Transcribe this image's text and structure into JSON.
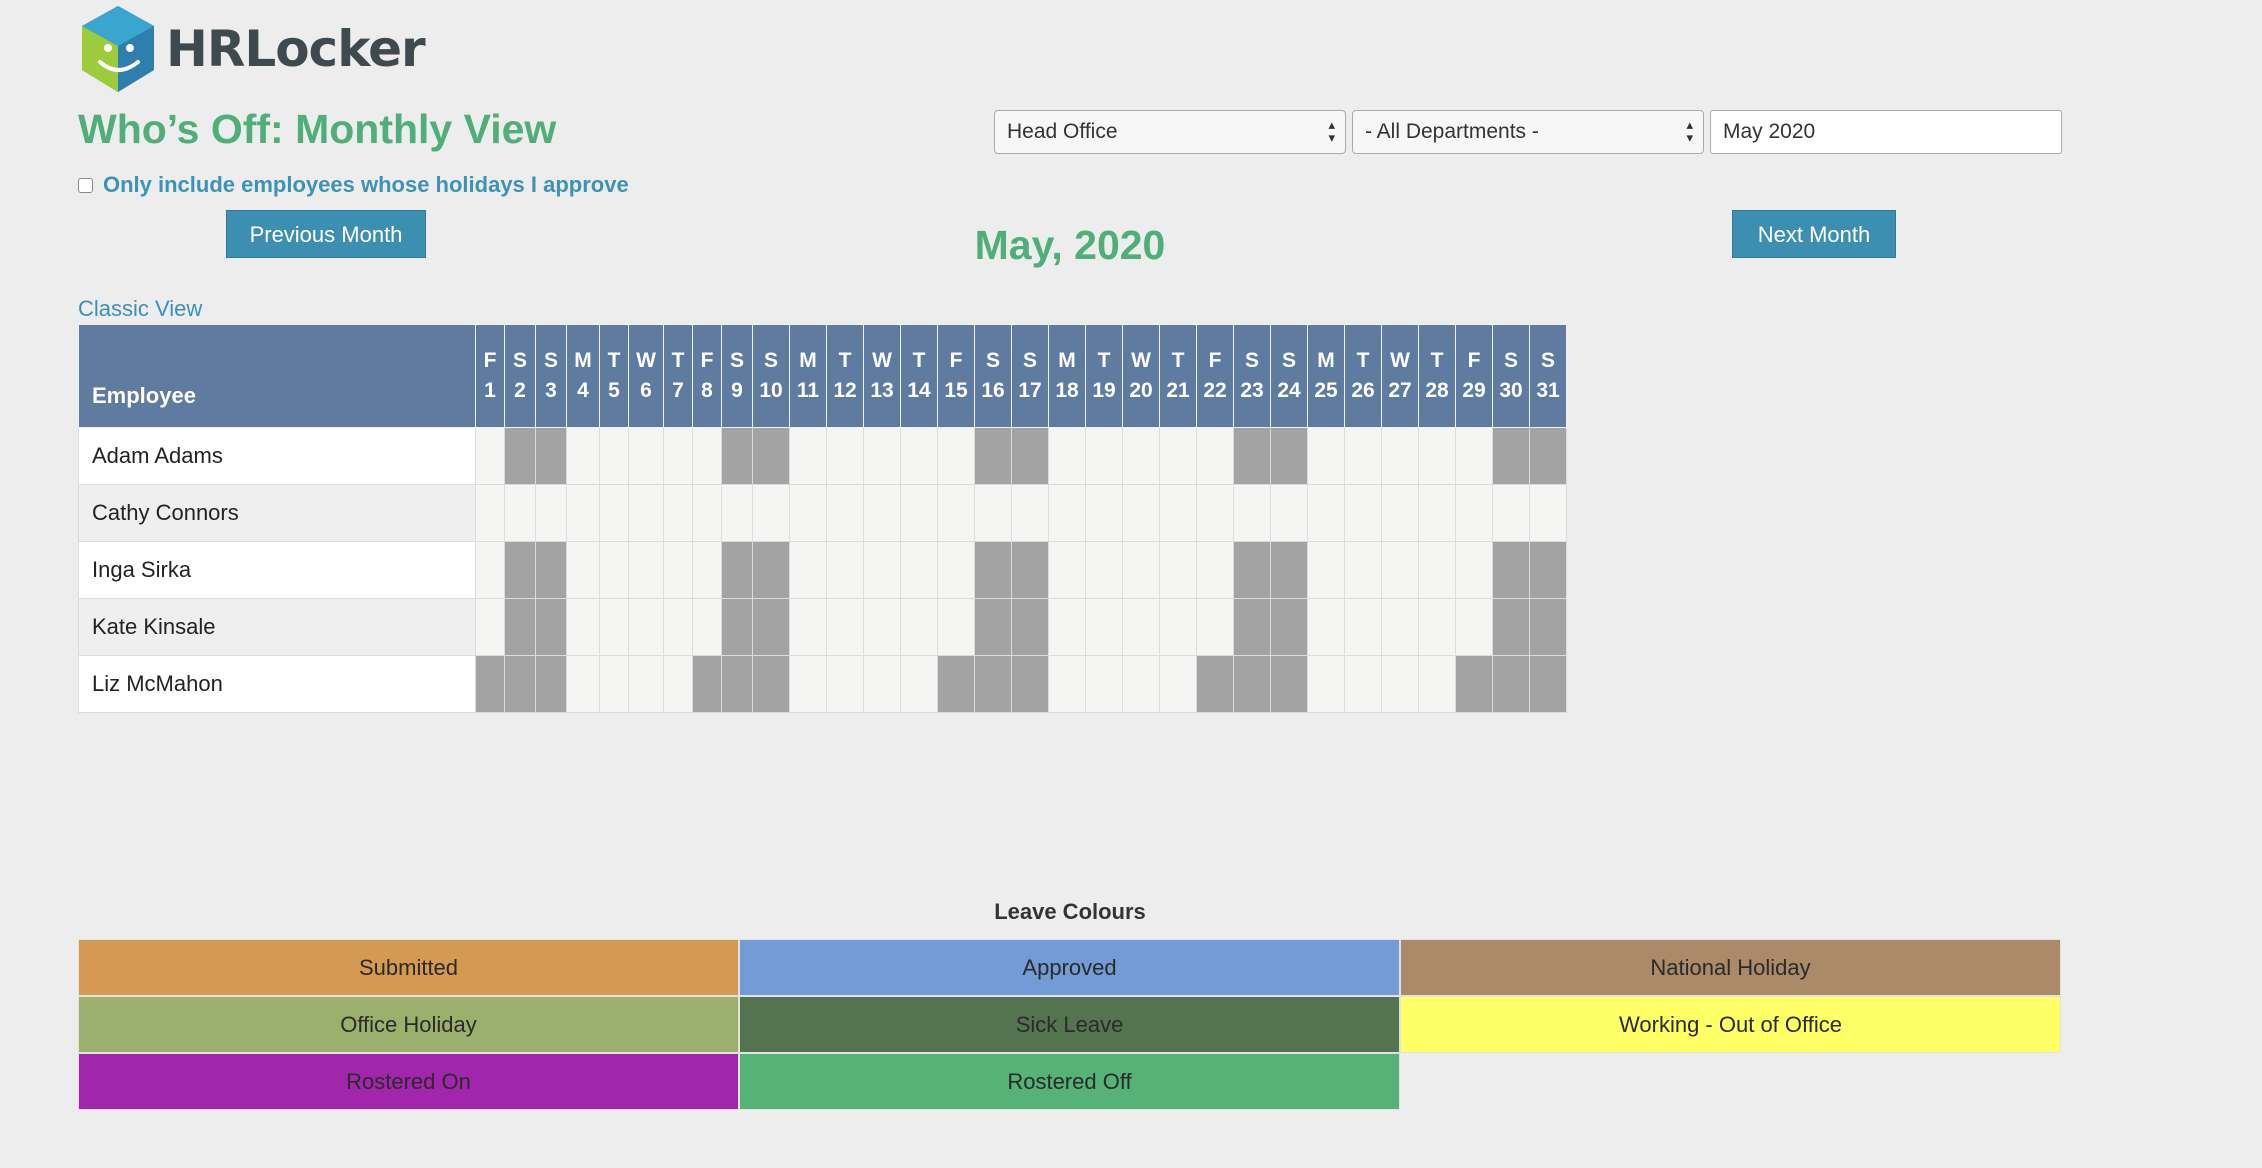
{
  "app": {
    "logo_text": "HRLocker"
  },
  "page": {
    "title": "Who’s Off: Monthly View",
    "month_heading": "May, 2020"
  },
  "filters": {
    "office": "Head Office",
    "department": "- All Departments -",
    "month": "May 2020"
  },
  "approve_filter": {
    "label": "Only include employees whose holidays I approve",
    "checked": false
  },
  "nav": {
    "previous_label": "Previous Month",
    "next_label": "Next Month",
    "classic_view_label": "Classic View"
  },
  "grid": {
    "employee_header": "Employee",
    "days": [
      {
        "dow": "F",
        "day": "1"
      },
      {
        "dow": "S",
        "day": "2"
      },
      {
        "dow": "S",
        "day": "3"
      },
      {
        "dow": "M",
        "day": "4"
      },
      {
        "dow": "T",
        "day": "5"
      },
      {
        "dow": "W",
        "day": "6"
      },
      {
        "dow": "T",
        "day": "7"
      },
      {
        "dow": "F",
        "day": "8"
      },
      {
        "dow": "S",
        "day": "9"
      },
      {
        "dow": "S",
        "day": "10"
      },
      {
        "dow": "M",
        "day": "11"
      },
      {
        "dow": "T",
        "day": "12"
      },
      {
        "dow": "W",
        "day": "13"
      },
      {
        "dow": "T",
        "day": "14"
      },
      {
        "dow": "F",
        "day": "15"
      },
      {
        "dow": "S",
        "day": "16"
      },
      {
        "dow": "S",
        "day": "17"
      },
      {
        "dow": "M",
        "day": "18"
      },
      {
        "dow": "T",
        "day": "19"
      },
      {
        "dow": "W",
        "day": "20"
      },
      {
        "dow": "T",
        "day": "21"
      },
      {
        "dow": "F",
        "day": "22"
      },
      {
        "dow": "S",
        "day": "23"
      },
      {
        "dow": "S",
        "day": "24"
      },
      {
        "dow": "M",
        "day": "25"
      },
      {
        "dow": "T",
        "day": "26"
      },
      {
        "dow": "W",
        "day": "27"
      },
      {
        "dow": "T",
        "day": "28"
      },
      {
        "dow": "F",
        "day": "29"
      },
      {
        "dow": "S",
        "day": "30"
      },
      {
        "dow": "S",
        "day": "31"
      }
    ],
    "employees": [
      {
        "name": "Adam Adams",
        "off_days": [
          2,
          3,
          9,
          10,
          16,
          17,
          23,
          24,
          30,
          31
        ]
      },
      {
        "name": "Cathy Connors",
        "off_days": []
      },
      {
        "name": "Inga Sirka",
        "off_days": [
          2,
          3,
          9,
          10,
          16,
          17,
          23,
          24,
          30,
          31
        ]
      },
      {
        "name": "Kate Kinsale",
        "off_days": [
          2,
          3,
          9,
          10,
          16,
          17,
          23,
          24,
          30,
          31
        ]
      },
      {
        "name": "Liz McMahon",
        "off_days": [
          1,
          2,
          3,
          8,
          9,
          10,
          15,
          16,
          17,
          22,
          23,
          24,
          29,
          30,
          31
        ]
      }
    ],
    "off_color": "#a3a3a3"
  },
  "legend": {
    "title": "Leave Colours",
    "items": [
      {
        "label": "Submitted",
        "color": "#d49a52"
      },
      {
        "label": "Approved",
        "color": "#739bd6"
      },
      {
        "label": "National Holiday",
        "color": "#ab8a69"
      },
      {
        "label": "Office Holiday",
        "color": "#9bb06c"
      },
      {
        "label": "Sick Leave",
        "color": "#53744f"
      },
      {
        "label": "Working - Out of Office",
        "color": "#ffff66"
      },
      {
        "label": "Rostered On",
        "color": "#a126ab"
      },
      {
        "label": "Rostered Off",
        "color": "#56b276"
      }
    ]
  }
}
